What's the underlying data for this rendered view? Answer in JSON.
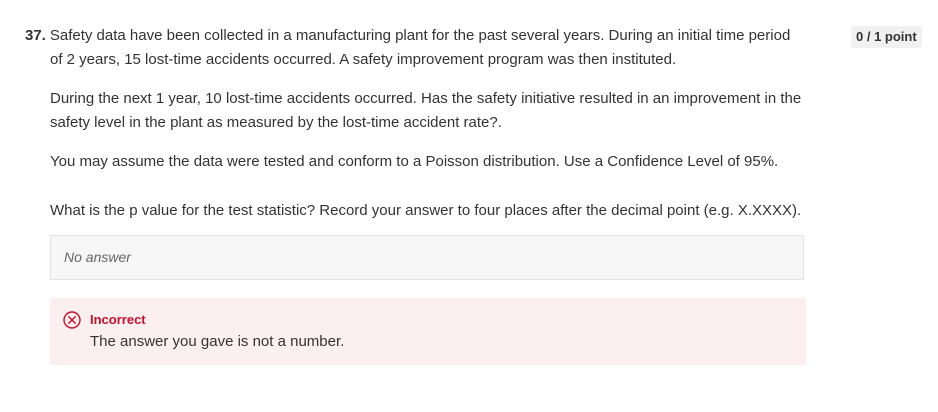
{
  "question": {
    "number": "37.",
    "line1": "Safety data have been collected in a manufacturing plant for the past several years. During an initial time period",
    "line2": "of 2 years, 15 lost-time accidents occurred. A safety improvement program was then instituted.",
    "para2_line1": "During the next 1 year, 10 lost-time accidents occurred. Has the safety initiative resulted in an improvement in the",
    "para2_line2": "safety level in the plant as measured by the lost-time accident rate?.",
    "para3": "You may assume the data were tested and conform to a Poisson distribution. Use a Confidence Level of 95%.",
    "para4": "What is the p value for the test statistic? Record your answer to four places after the decimal point (e.g. X.XXXX)."
  },
  "score": {
    "label": "0 / 1 point"
  },
  "answer": {
    "value": "No answer"
  },
  "feedback": {
    "icon": "incorrect-x-icon",
    "title": "Incorrect",
    "message": "The answer you gave is not a number.",
    "accent_color": "#c8102e",
    "background_color": "#fbeff0"
  }
}
